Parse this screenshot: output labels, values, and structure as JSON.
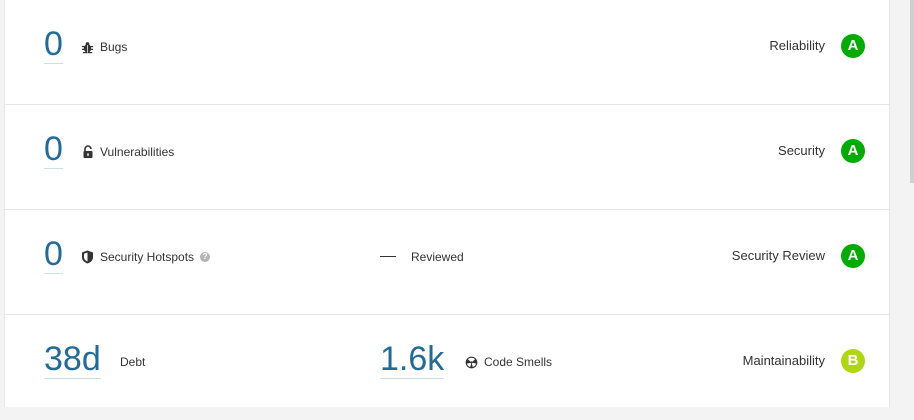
{
  "colors": {
    "metric_value": "#236a97",
    "rating_a": "#00aa00",
    "rating_b": "#b0d513"
  },
  "rows": [
    {
      "value": "0",
      "label": "Bugs",
      "icon": "bug-icon",
      "rating_label": "Reliability",
      "rating": "A"
    },
    {
      "value": "0",
      "label": "Vulnerabilities",
      "icon": "lock-icon",
      "rating_label": "Security",
      "rating": "A"
    },
    {
      "value": "0",
      "label": "Security Hotspots",
      "icon": "shield-icon",
      "help_icon": "question-icon",
      "secondary_value": "—",
      "secondary_label": "Reviewed",
      "rating_label": "Security Review",
      "rating": "A"
    },
    {
      "value": "38d",
      "label": "Debt",
      "secondary_value": "1.6k",
      "secondary_label": "Code Smells",
      "secondary_icon": "code-smell-icon",
      "rating_label": "Maintainability",
      "rating": "B"
    }
  ]
}
